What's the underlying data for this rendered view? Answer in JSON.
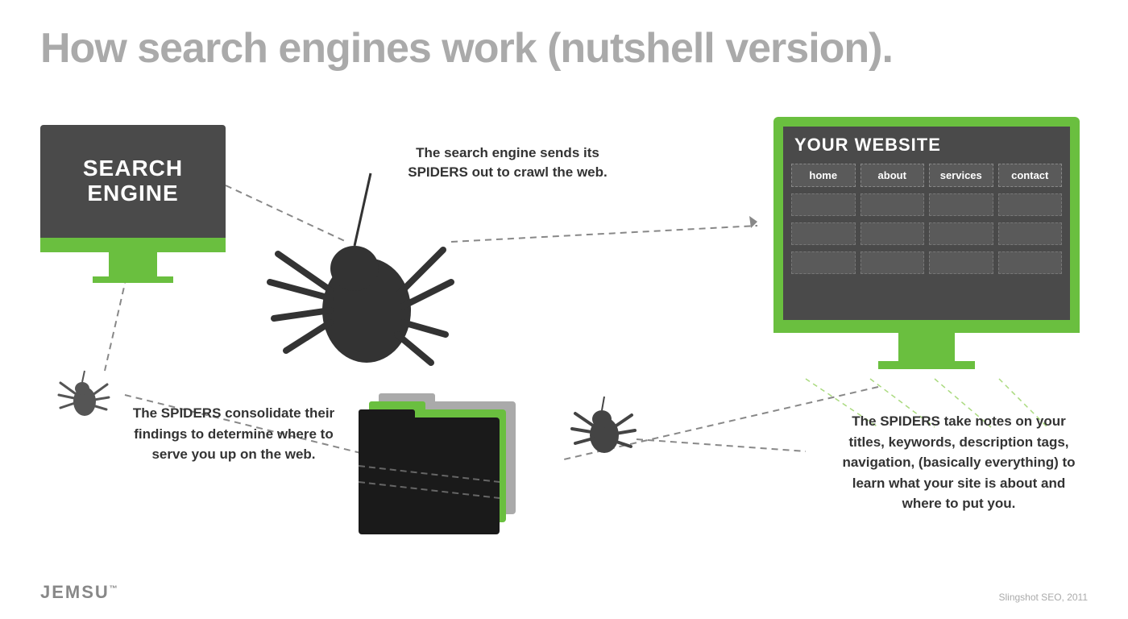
{
  "title": "How search engines work (nutshell version).",
  "search_engine": {
    "label_line1": "SEARCH",
    "label_line2": "ENGINE"
  },
  "website": {
    "title": "YOUR WEBSITE",
    "nav_items": [
      "home",
      "about",
      "services",
      "contact"
    ]
  },
  "annotations": {
    "top": "The search engine sends its SPIDERS out to crawl the web.",
    "bottom_left": "The SPIDERS consolidate their findings to determine where to serve you up on the web.",
    "bottom_right": "The SPIDERS take notes on your titles, keywords, description tags, navigation, (basically everything) to learn what your site is about and where to put you."
  },
  "brand": {
    "name": "JEMSU",
    "tm": "™"
  },
  "credit": "Slingshot SEO, 2011",
  "colors": {
    "green": "#6abf3f",
    "dark_gray": "#4a4a4a",
    "medium_gray": "#5a5a5a",
    "spider_color": "#333333",
    "text_dark": "#333333",
    "text_light_gray": "#aaaaaa"
  }
}
